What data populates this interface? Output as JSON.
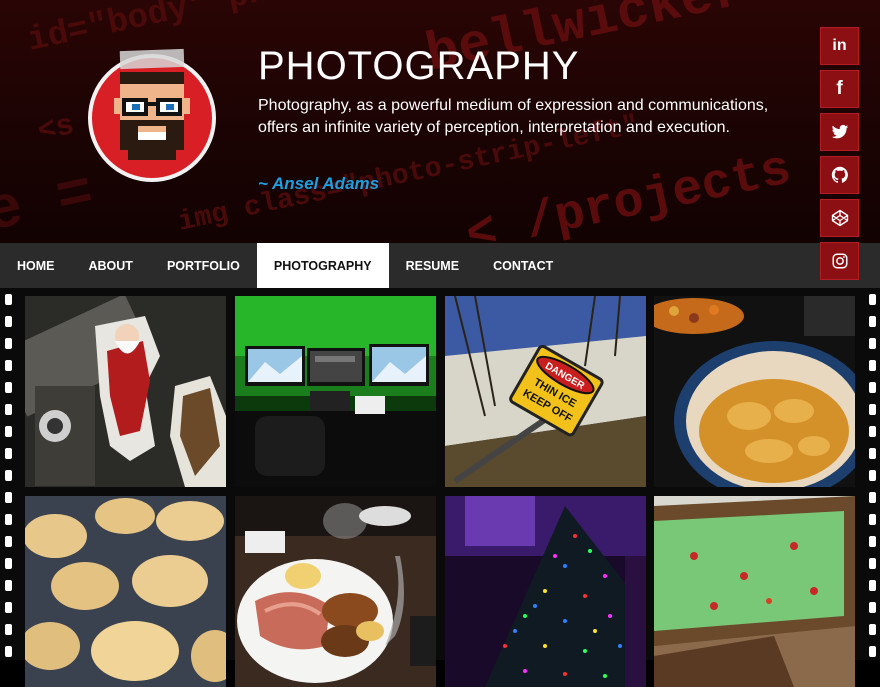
{
  "header": {
    "title": "PHOTOGRAPHY",
    "quote": "Photography, as a powerful medium of expression and communications, offers an infinite variety of perception, interpretation and execution.",
    "author": "~ Ansel Adams",
    "background_code": [
      "id=\"body\" pha",
      "bellwicker",
      "<s    <div",
      "img class=\"photo-strip-left\"",
      "< /projects",
      "e ="
    ]
  },
  "social": [
    {
      "name": "linkedin",
      "glyph": "in"
    },
    {
      "name": "facebook",
      "glyph": "f"
    },
    {
      "name": "twitter",
      "glyph": "twitter-icon"
    },
    {
      "name": "github",
      "glyph": "github-icon"
    },
    {
      "name": "codepen",
      "glyph": "codepen-icon"
    },
    {
      "name": "instagram",
      "glyph": "instagram-icon"
    }
  ],
  "nav": {
    "items": [
      "HOME",
      "ABOUT",
      "PORTFOLIO",
      "PHOTOGRAPHY",
      "RESUME",
      "CONTACT"
    ],
    "active": "PHOTOGRAPHY"
  },
  "photos": [
    {
      "name": "santa-stickers-photo"
    },
    {
      "name": "desk-monitors-photo"
    },
    {
      "name": "danger-thin-ice-sign-photo",
      "sign_lines": [
        "DANGER",
        "THIN ICE",
        "KEEP OFF"
      ]
    },
    {
      "name": "frying-pot-photo"
    },
    {
      "name": "ravioli-photo"
    },
    {
      "name": "roast-dinner-photo"
    },
    {
      "name": "christmas-lights-photo"
    },
    {
      "name": "green-bread-photo"
    }
  ],
  "colors": {
    "header_bg": "#1a0303",
    "accent_red": "#8c0f14",
    "author_blue": "#1e9fe0",
    "nav_bg": "#2b2b2b",
    "nav_active_bg": "#ffffff"
  }
}
